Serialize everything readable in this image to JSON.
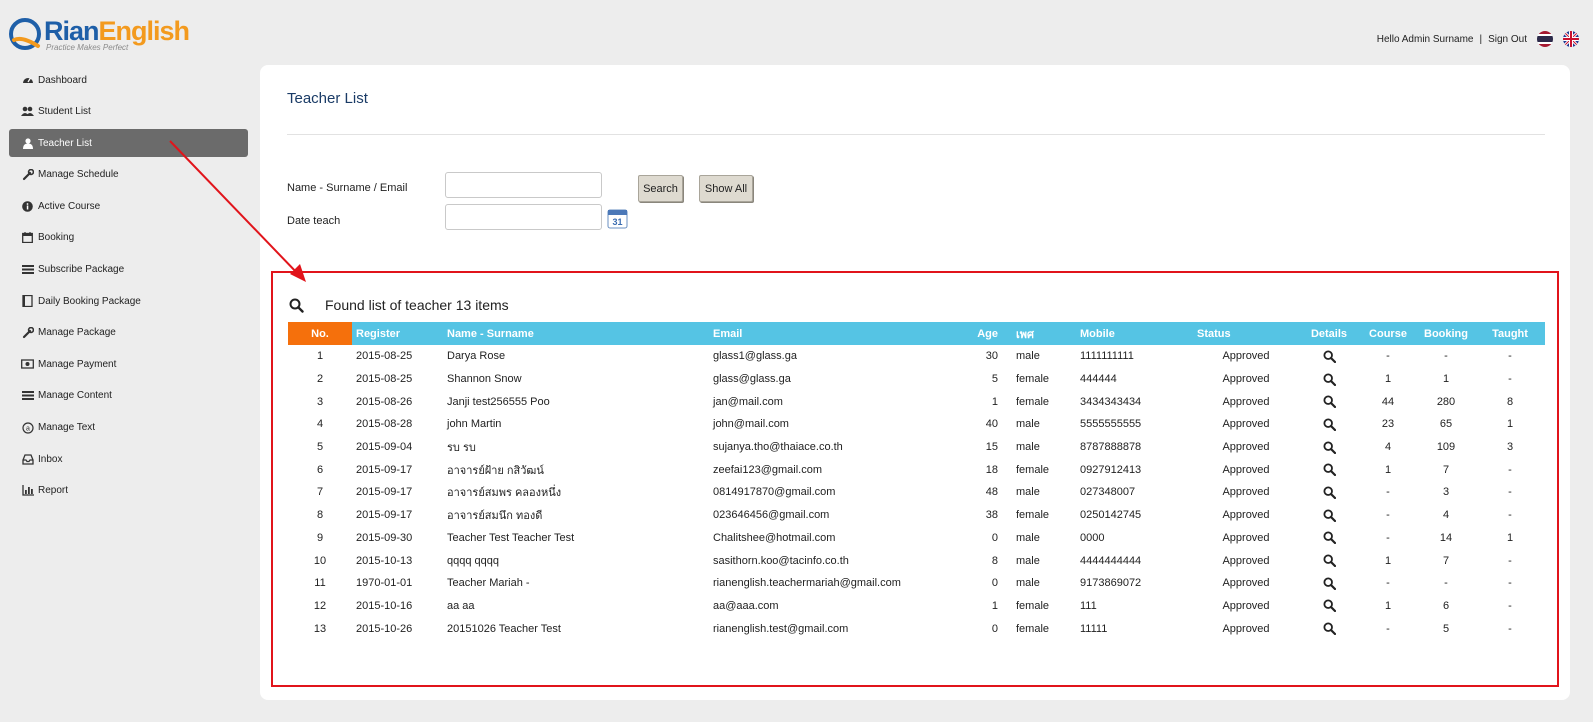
{
  "brand": {
    "name_part1": "Rian",
    "name_part2": "English",
    "tagline": "Practice Makes Perfect",
    "color_primary": "#1e5fa8",
    "color_accent": "#f39a1e"
  },
  "topbar": {
    "greeting": "Hello Admin Surname",
    "separator": "|",
    "sign_out": "Sign Out",
    "flags": [
      "thai-flag-icon",
      "uk-flag-icon"
    ]
  },
  "sidebar": {
    "items": [
      {
        "label": "Dashboard",
        "icon": "dashboard-icon"
      },
      {
        "label": "Student List",
        "icon": "users-icon"
      },
      {
        "label": "Teacher List",
        "icon": "user-icon",
        "active": true
      },
      {
        "label": "Manage Schedule",
        "icon": "wrench-icon"
      },
      {
        "label": "Active Course",
        "icon": "info-circle-icon"
      },
      {
        "label": "Booking",
        "icon": "calendar-icon"
      },
      {
        "label": "Subscribe Package",
        "icon": "list-icon"
      },
      {
        "label": "Daily Booking Package",
        "icon": "book-icon"
      },
      {
        "label": "Manage Package",
        "icon": "wrench-icon"
      },
      {
        "label": "Manage Payment",
        "icon": "money-icon"
      },
      {
        "label": "Manage Content",
        "icon": "list-icon"
      },
      {
        "label": "Manage Text",
        "icon": "text-icon"
      },
      {
        "label": "Inbox",
        "icon": "inbox-icon"
      },
      {
        "label": "Report",
        "icon": "bar-chart-icon"
      }
    ]
  },
  "main": {
    "title": "Teacher List",
    "form": {
      "name_label": "Name - Surname / Email",
      "name_value": "",
      "date_label": "Date teach",
      "date_value": "",
      "calendar_day": "31",
      "search_button": "Search",
      "show_all_button": "Show All"
    },
    "results": {
      "summary": "Found list of teacher 13 items",
      "columns": [
        "No.",
        "Register",
        "Name - Surname",
        "Email",
        "Age",
        "เพศ",
        "Mobile",
        "Status",
        "Details",
        "Course",
        "Booking",
        "Taught"
      ],
      "rows": [
        [
          "1",
          "2015-08-25",
          "Darya Rose",
          "glass1@glass.ga",
          "30",
          "male",
          "1111111111",
          "Approved",
          "-",
          "-",
          "-"
        ],
        [
          "2",
          "2015-08-25",
          "Shannon Snow",
          "glass@glass.ga",
          "5",
          "female",
          "444444",
          "Approved",
          "1",
          "1",
          "-"
        ],
        [
          "3",
          "2015-08-26",
          "Janji test256555 Poo",
          "jan@mail.com",
          "1",
          "female",
          "3434343434",
          "Approved",
          "44",
          "280",
          "8"
        ],
        [
          "4",
          "2015-08-28",
          "john Martin",
          "john@mail.com",
          "40",
          "male",
          "5555555555",
          "Approved",
          "23",
          "65",
          "1"
        ],
        [
          "5",
          "2015-09-04",
          "รบ รบ",
          "sujanya.tho@thaiace.co.th",
          "15",
          "male",
          "8787888878",
          "Approved",
          "4",
          "109",
          "3"
        ],
        [
          "6",
          "2015-09-17",
          "อาจารย์ฝ้าย กสิวัฒน์",
          "zeefai123@gmail.com",
          "18",
          "female",
          "0927912413",
          "Approved",
          "1",
          "7",
          "-"
        ],
        [
          "7",
          "2015-09-17",
          "อาจารย์สมพร คลองหนึ่ง",
          "0814917870@gmail.com",
          "48",
          "male",
          "027348007",
          "Approved",
          "-",
          "3",
          "-"
        ],
        [
          "8",
          "2015-09-17",
          "อาจารย์สมนึก ทองดี",
          "023646456@gmail.com",
          "38",
          "female",
          "0250142745",
          "Approved",
          "-",
          "4",
          "-"
        ],
        [
          "9",
          "2015-09-30",
          "Teacher Test Teacher Test",
          "Chalitshee@hotmail.com",
          "0",
          "male",
          "0000",
          "Approved",
          "-",
          "14",
          "1"
        ],
        [
          "10",
          "2015-10-13",
          "qqqq qqqq",
          "sasithorn.koo@tacinfo.co.th",
          "8",
          "male",
          "4444444444",
          "Approved",
          "1",
          "7",
          "-"
        ],
        [
          "11",
          "1970-01-01",
          "Teacher Mariah -",
          " rianenglish.teachermariah@gmail.com",
          "0",
          "male",
          "9173869072",
          "Approved",
          "-",
          "-",
          "-"
        ],
        [
          "12",
          "2015-10-16",
          "aa aa",
          "aa@aaa.com",
          "1",
          "female",
          "111",
          "Approved",
          "1",
          "6",
          "-"
        ],
        [
          "13",
          "2015-10-26",
          "20151026 Teacher Test",
          "rianenglish.test@gmail.com",
          "0",
          "female",
          "11111",
          "Approved",
          "-",
          "5",
          "-"
        ]
      ]
    }
  },
  "colors": {
    "header_blue": "#55c4e4",
    "header_orange": "#f5700c",
    "approved_green": "#1f9a2a",
    "annotation_red": "#e1141b",
    "sidebar_active": "#6b6b6b"
  }
}
